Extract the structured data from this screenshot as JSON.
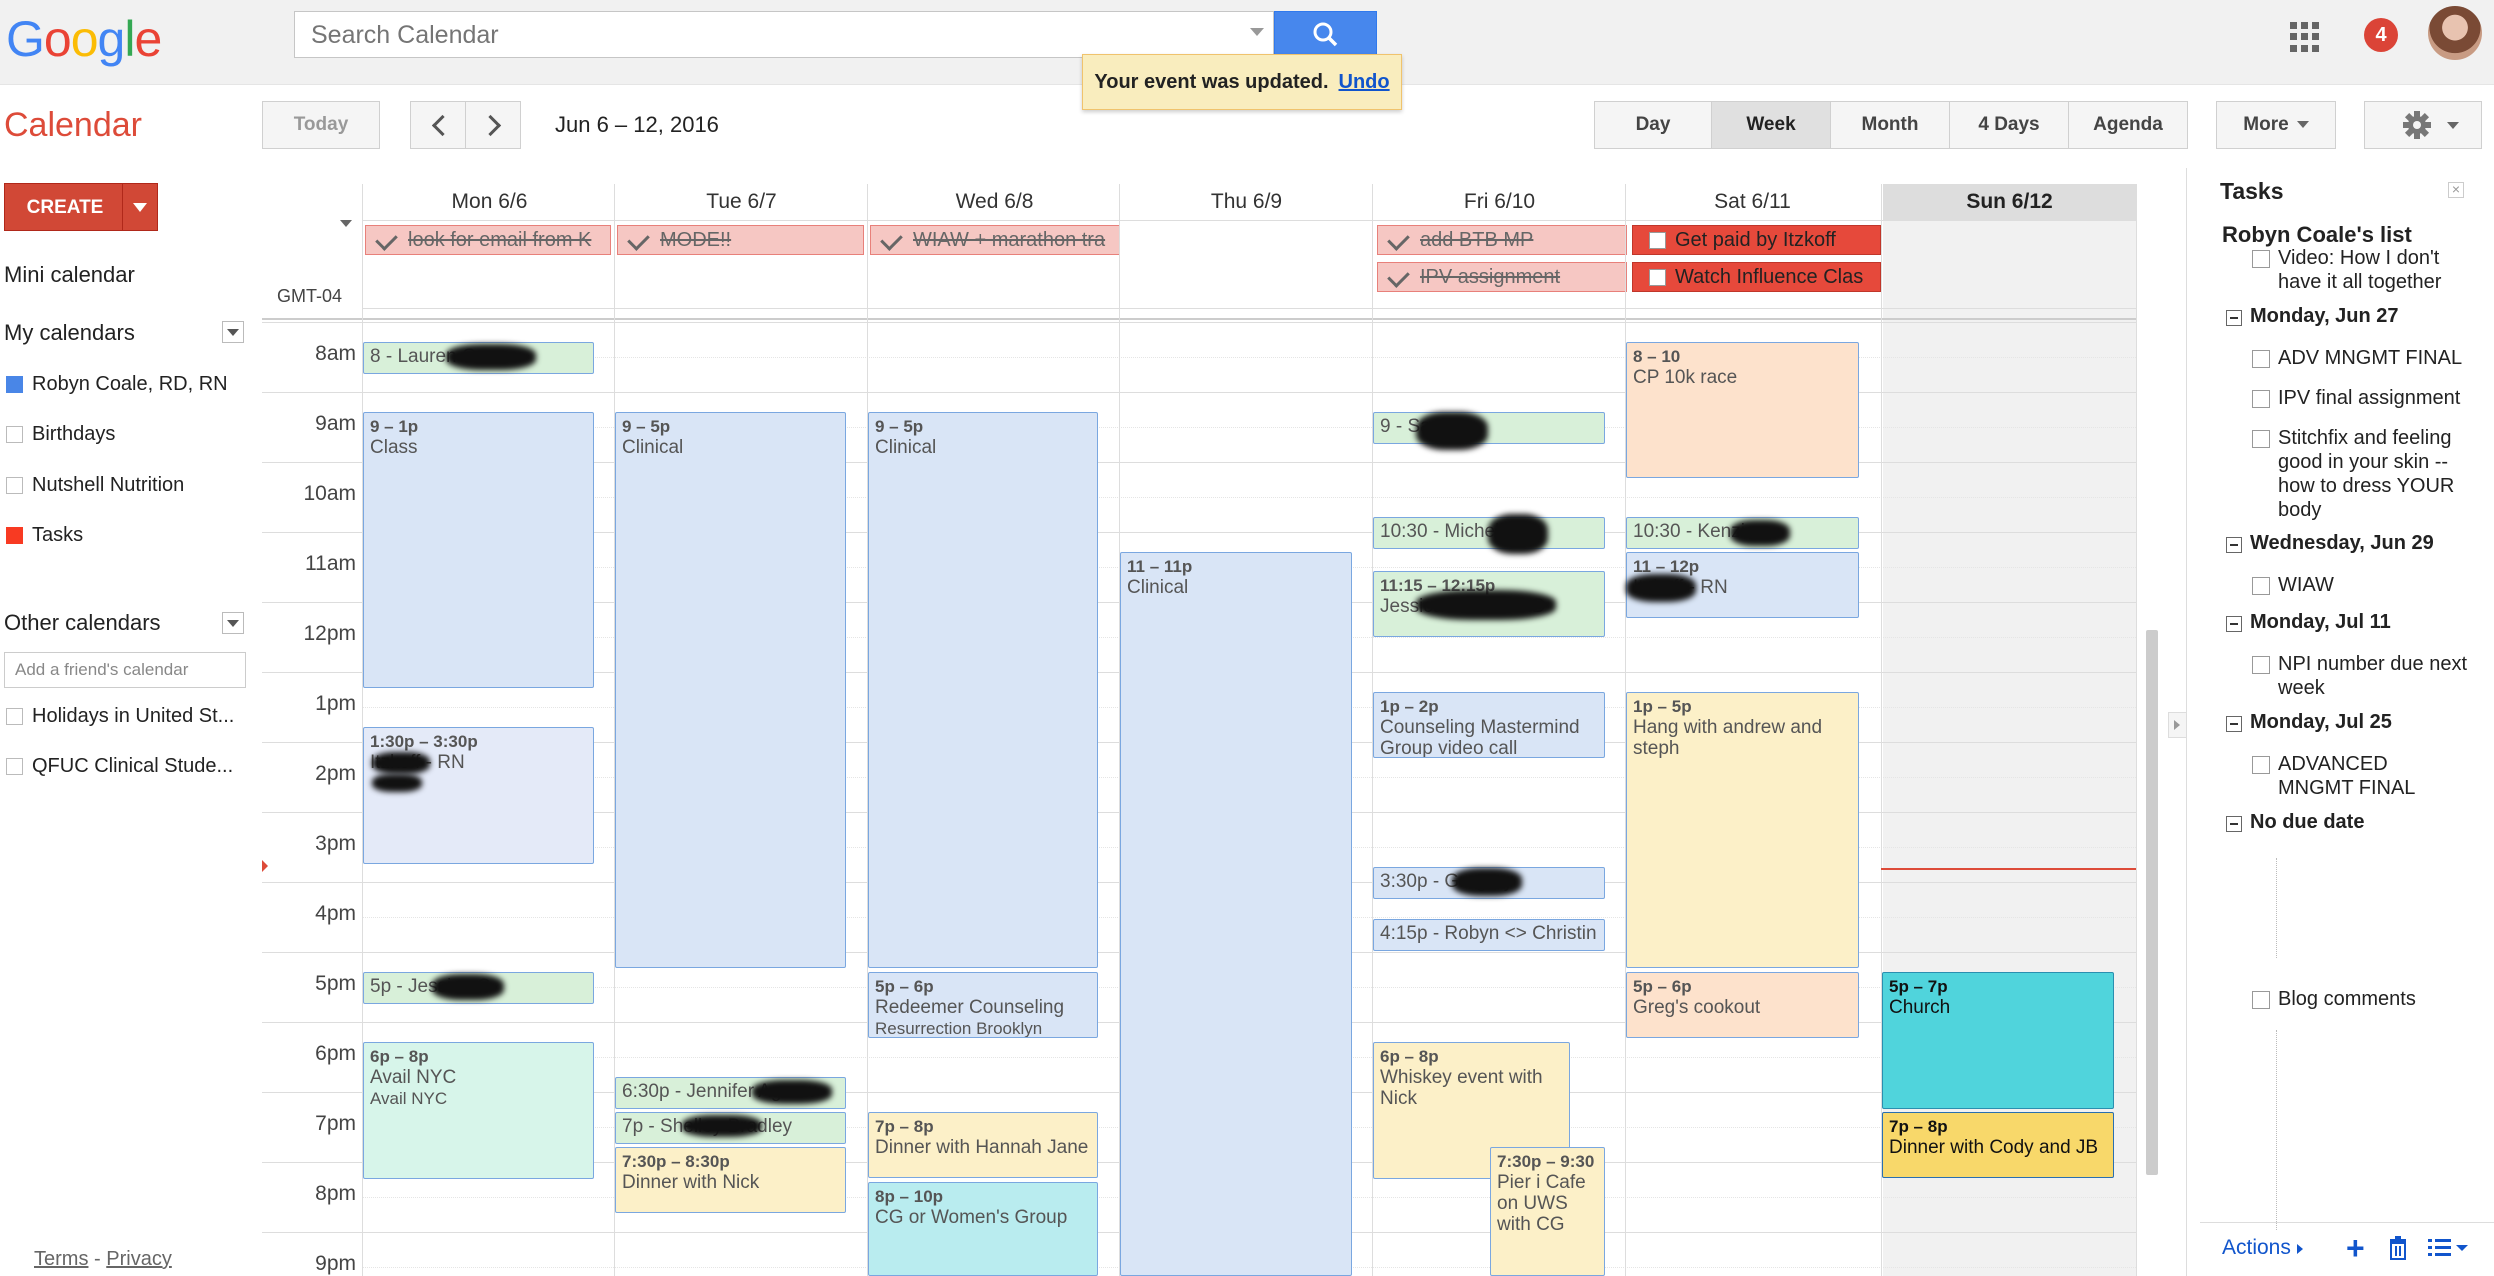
{
  "header": {
    "logo": "Google",
    "search_placeholder": "Search Calendar",
    "notification_count": "4",
    "toast_message": "Your event was updated.",
    "toast_undo": "Undo"
  },
  "toolbar": {
    "app_title": "Calendar",
    "today": "Today",
    "date_range": "Jun 6 – 12, 2016",
    "views": {
      "day": "Day",
      "week": "Week",
      "month": "Month",
      "four_days": "4 Days",
      "agenda": "Agenda"
    },
    "more": "More"
  },
  "sidebar": {
    "create": "CREATE",
    "mini_calendar": "Mini calendar",
    "my_calendars_title": "My calendars",
    "my_calendars": [
      {
        "label": "Robyn Coale, RD, RN",
        "color": "#4986e7"
      },
      {
        "label": "Birthdays",
        "color": ""
      },
      {
        "label": "Nutshell Nutrition",
        "color": ""
      },
      {
        "label": "Tasks",
        "color": "#f83a22"
      }
    ],
    "other_calendars_title": "Other calendars",
    "friend_placeholder": "Add a friend's calendar",
    "other_calendars": [
      {
        "label": "Holidays in United St..."
      },
      {
        "label": "QFUC Clinical Stude..."
      }
    ],
    "footer_terms": "Terms",
    "footer_sep": "-",
    "footer_privacy": "Privacy"
  },
  "grid": {
    "timezone": "GMT-04",
    "days": [
      "Mon 6/6",
      "Tue 6/7",
      "Wed 6/8",
      "Thu 6/9",
      "Fri 6/10",
      "Sat 6/11",
      "Sun 6/12"
    ],
    "hours": [
      "8am",
      "9am",
      "10am",
      "11am",
      "12pm",
      "1pm",
      "2pm",
      "3pm",
      "4pm",
      "5pm",
      "6pm",
      "7pm",
      "8pm",
      "9pm"
    ],
    "all_day": {
      "mon": "look for email from K",
      "tue": "MODE!!",
      "wed": "WIAW + marathon tra",
      "fri_1": "add BTB MP",
      "fri_2": "IPV assignment",
      "sat_1": "Get paid by Itzkoff",
      "sat_2": "Watch Influence Clas"
    },
    "events": {
      "mon_1": {
        "time": "",
        "title": "8 - Lauren Green"
      },
      "mon_2": {
        "time": "9 – 1p",
        "title": "Class"
      },
      "mon_3": {
        "time": "1:30p – 3:30p",
        "title": "Itzkoff - RN"
      },
      "mon_4": {
        "time": "",
        "title": "5p - Jessica C"
      },
      "mon_5": {
        "time": "6p – 8p",
        "title": "Avail NYC",
        "sub": "Avail NYC"
      },
      "tue_1": {
        "time": "9 – 5p",
        "title": "Clinical"
      },
      "tue_2": {
        "time": "",
        "title": "6:30p - Jennifer Agnew"
      },
      "tue_3": {
        "time": "",
        "title": "7p - Shelley Bradley"
      },
      "tue_4": {
        "time": "7:30p – 8:30p",
        "title": "Dinner with Nick"
      },
      "wed_1": {
        "time": "9 – 5p",
        "title": "Clinical"
      },
      "wed_2": {
        "time": "5p – 6p",
        "title": "Redeemer Counseling",
        "sub": "Resurrection Brooklyn"
      },
      "wed_3": {
        "time": "7p – 8p",
        "title": "Dinner with Hannah Jane"
      },
      "wed_4": {
        "time": "8p – 10p",
        "title": "CG or Women's Group"
      },
      "thu_1": {
        "time": "11 – 11p",
        "title": "Clinical"
      },
      "fri_1": {
        "time": "",
        "title": "9 - Sarah"
      },
      "fri_2": {
        "time": "",
        "title": "10:30 - Michelle"
      },
      "fri_3": {
        "time": "11:15 – 12:15p",
        "title": "Jessica Mitchell RD"
      },
      "fri_4": {
        "time": "1p – 2p",
        "title": "Counseling Mastermind Group video call"
      },
      "fri_5": {
        "time": "",
        "title": "3:30p - Gregory"
      },
      "fri_6": {
        "time": "",
        "title": "4:15p - Robyn <> Christin"
      },
      "fri_7": {
        "time": "6p – 8p",
        "title": "Whiskey event with Nick"
      },
      "fri_8": {
        "time": "7:30p – 9:30",
        "title": "Pier i Cafe on UWS with CG"
      },
      "sat_1": {
        "time": "8 – 10",
        "title": "CP 10k race"
      },
      "sat_2": {
        "time": "",
        "title": "10:30 - Kenzie"
      },
      "sat_3": {
        "time": "11 – 12p",
        "title": "Itzkoff - RN"
      },
      "sat_4": {
        "time": "1p – 5p",
        "title": "Hang with andrew and steph"
      },
      "sat_5": {
        "time": "5p – 6p",
        "title": "Greg's cookout"
      },
      "sun_1": {
        "time": "5p – 7p",
        "title": "Church"
      },
      "sun_2": {
        "time": "7p – 8p",
        "title": "Dinner with Cody and JB"
      }
    }
  },
  "tasks": {
    "title": "Tasks",
    "list_name": "Robyn Coale's list",
    "items": {
      "t1": "Video: How I don't have it all together",
      "g1": "Monday, Jun 27",
      "t2": "ADV MNGMT FINAL",
      "t3": "IPV final assignment",
      "t4": "Stitchfix and feeling good in your skin -- how to dress YOUR body",
      "g2": "Wednesday, Jun 29",
      "t5": "WIAW",
      "g3": "Monday, Jul 11",
      "t6": "NPI number due next week",
      "g4": "Monday, Jul 25",
      "t7": "ADVANCED MNGMT FINAL",
      "g5": "No due date",
      "t8": "Blog comments"
    },
    "actions": "Actions"
  },
  "colors": {
    "accent_red": "#dd4b39",
    "search_blue": "#4787ed",
    "today_line": "#dd4b39"
  }
}
